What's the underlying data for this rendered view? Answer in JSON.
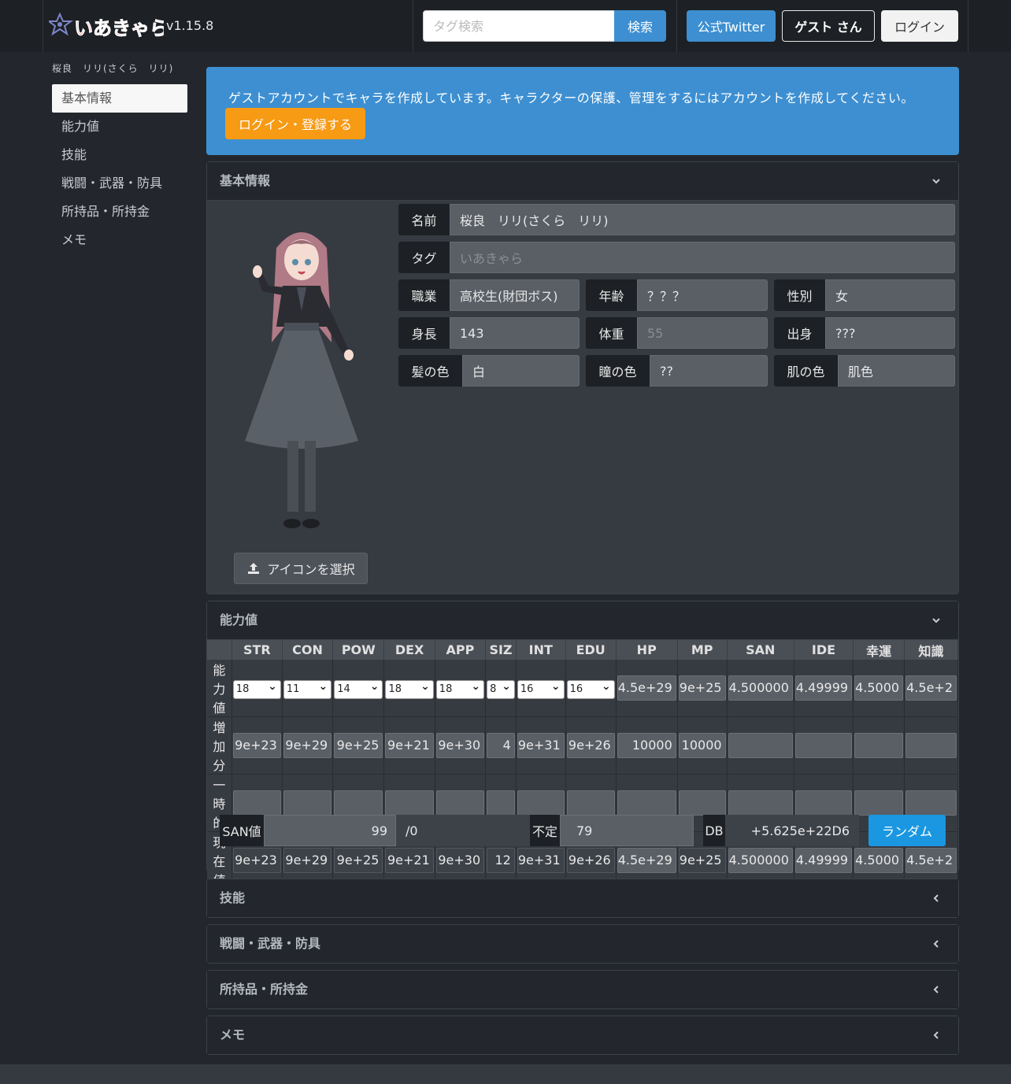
{
  "header": {
    "version": "v1.15.8",
    "search_placeholder": "タグ検索",
    "search_label": "検索",
    "twitter_label": "公式Twitter",
    "guest_label": "ゲスト さん",
    "login_label": "ログイン",
    "logo_text": "いあきゃら"
  },
  "sidebar": {
    "char_name": "桜良　リリ(さくら　リリ)",
    "items": [
      {
        "label": "基本情報"
      },
      {
        "label": "能力値"
      },
      {
        "label": "技能"
      },
      {
        "label": "戦闘・武器・防具"
      },
      {
        "label": "所持品・所持金"
      },
      {
        "label": "メモ"
      }
    ]
  },
  "notice": {
    "text": "ゲストアカウントでキャラを作成しています。キャラクターの保護、管理をするにはアカウントを作成してください。",
    "button": "ログイン・登録する"
  },
  "basic": {
    "title": "基本情報",
    "icon_button": "アイコンを選択",
    "name_label": "名前",
    "name_value": "桜良　リリ(さくら　リリ)",
    "tag_label": "タグ",
    "tag_placeholder": "いあきゃら",
    "job_label": "職業",
    "job_value": "高校生(財団ボス)",
    "age_label": "年齢",
    "age_value": "？？？",
    "sex_label": "性別",
    "sex_value": "女",
    "height_label": "身長",
    "height_value": "143",
    "weight_label": "体重",
    "weight_placeholder": "55",
    "origin_label": "出身",
    "origin_value": "???",
    "hair_label": "髪の色",
    "hair_value": "白",
    "eye_label": "瞳の色",
    "eye_value": "??",
    "skin_label": "肌の色",
    "skin_value": "肌色"
  },
  "ability": {
    "title": "能力値",
    "headers": [
      "STR",
      "CON",
      "POW",
      "DEX",
      "APP",
      "SIZ",
      "INT",
      "EDU",
      "HP",
      "MP",
      "SAN",
      "IDE",
      "幸運",
      "知識"
    ],
    "row_labels": [
      "能力値",
      "増加分",
      "一時的",
      "現在値"
    ],
    "base": [
      "18",
      "11",
      "14",
      "18",
      "18",
      "8",
      "16",
      "16",
      "4.5e+29",
      "9e+25",
      "4.500000",
      "4.49999",
      "4.5000",
      "4.5e+2"
    ],
    "added": [
      "9e+23",
      "9e+29",
      "9e+25",
      "9e+21",
      "9e+30",
      "4",
      "9e+31",
      "9e+26",
      "10000",
      "10000",
      "",
      "",
      "",
      ""
    ],
    "temp": [
      "",
      "",
      "",
      "",
      "",
      "",
      "",
      "",
      "",
      "",
      "",
      "",
      "",
      ""
    ],
    "current": [
      "9e+23",
      "9e+29",
      "9e+25",
      "9e+21",
      "9e+30",
      "12",
      "9e+31",
      "9e+26",
      "4.5e+29",
      "9e+25",
      "4.500000",
      "4.49999",
      "4.5000",
      "4.5e+2"
    ],
    "san_label": "SAN値",
    "san_value": "99",
    "san_max": "/0",
    "indef_label": "不定",
    "indef_value": "79",
    "db_label": "DB",
    "db_value": "+5.625e+22D6",
    "random_label": "ランダム"
  },
  "sections": {
    "skills": "技能",
    "combat": "戦闘・武器・防具",
    "items": "所持品・所持金",
    "memo": "メモ"
  },
  "colors": {
    "accent": "#3d8fd1",
    "orange": "#f79a14",
    "random": "#1a97e0",
    "background": "#23272d"
  }
}
